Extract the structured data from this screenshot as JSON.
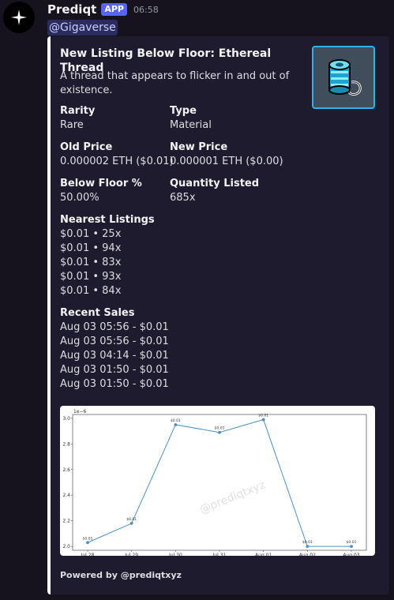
{
  "message": {
    "bot_name": "Prediqt",
    "badge": "APP",
    "time": "06:58",
    "mention": "@Gigaverse"
  },
  "embed": {
    "title": "New Listing Below Floor: Ethereal Thread",
    "description": "A thread that appears to flicker in and out of existence.",
    "fields": {
      "rarity": {
        "name": "Rarity",
        "value": "Rare"
      },
      "type": {
        "name": "Type",
        "value": "Material"
      },
      "old_price": {
        "name": "Old Price",
        "value": "0.000002 ETH ($0.01)"
      },
      "new_price": {
        "name": "New Price",
        "value": "0.000001 ETH ($0.00)"
      },
      "below_floor": {
        "name": "Below Floor %",
        "value": "50.00%"
      },
      "quantity": {
        "name": "Quantity Listed",
        "value": "685x"
      }
    },
    "nearest_listings": {
      "name": "Nearest Listings",
      "items": [
        "$0.01 • 25x",
        "$0.01 • 94x",
        "$0.01 • 83x",
        "$0.01 • 93x",
        "$0.01 • 84x"
      ]
    },
    "recent_sales": {
      "name": "Recent Sales",
      "items": [
        "Aug 03 05:56 - $0.01",
        "Aug 03 05:56 - $0.01",
        "Aug 03 04:14 - $0.01",
        "Aug 03 01:50 - $0.01",
        "Aug 03 01:50 - $0.01"
      ]
    },
    "footer": "Powered by @prediqtxyz",
    "accent_color": "#ffffff",
    "thumbnail_icon": "thread-spool-icon"
  },
  "chart_data": {
    "type": "line",
    "categories": [
      "Jul 28",
      "Jul 29",
      "Jul 30",
      "Jul 31",
      "Aug 01",
      "Aug 02",
      "Aug 03"
    ],
    "values": [
      2.03,
      2.18,
      2.95,
      2.89,
      2.99,
      2.0,
      2.0
    ],
    "data_labels": [
      "$0.01",
      "$0.01",
      "$0.01",
      "$0.01",
      "$0.01",
      "$0.01",
      "$0.01"
    ],
    "y_ticks": [
      "2.0",
      "2.2",
      "2.4",
      "2.6",
      "2.8",
      "3.0"
    ],
    "y_exponent": "1e−6",
    "ylim": [
      1.97,
      3.03
    ],
    "watermark": "@prediqtxyz",
    "line_color": "#4a8fc4"
  }
}
